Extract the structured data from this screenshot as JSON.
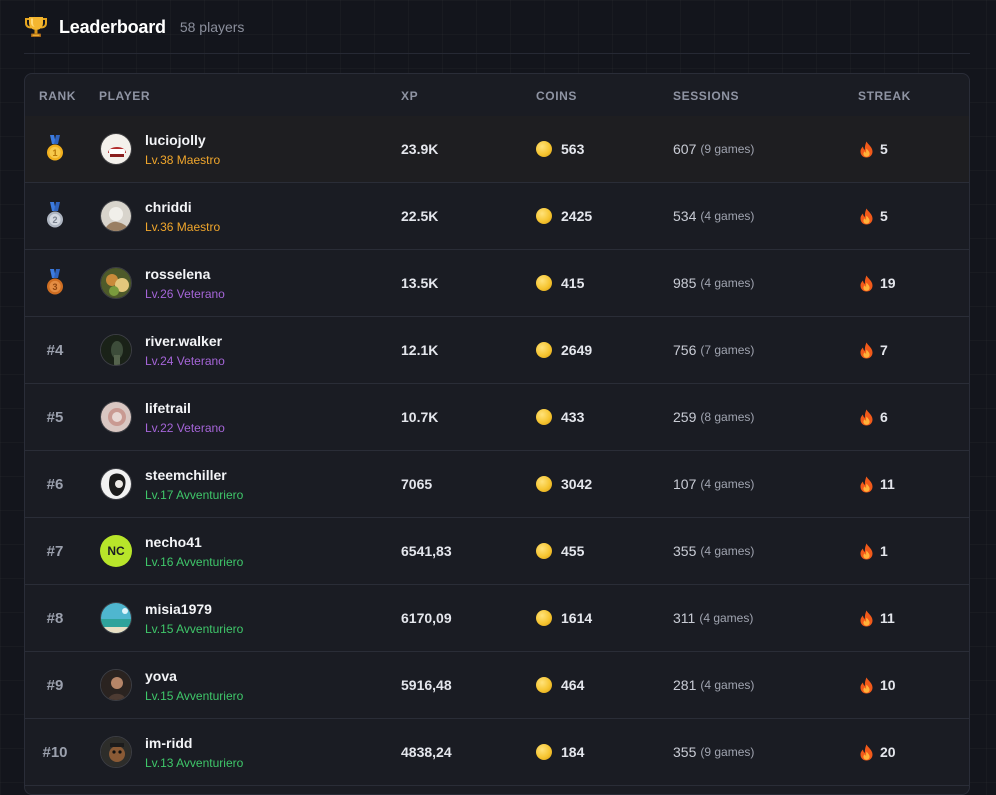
{
  "header": {
    "title": "Leaderboard",
    "count": "58 players",
    "trophy_icon": "trophy-icon"
  },
  "colors": {
    "background": "#13151c",
    "panel": "#1a1c23",
    "maestro": "#f0a62c",
    "veterano": "#a565d8",
    "avventuriero": "#3fc76a",
    "coin": "#f6c531",
    "gold_medal": "#f2b01e",
    "silver_medal": "#b8bec9",
    "bronze_medal": "#d9782a"
  },
  "columns": {
    "rank": "RANK",
    "player": "PLAYER",
    "xp": "XP",
    "coins": "COINS",
    "sessions": "SESSIONS",
    "streak": "STREAK"
  },
  "rows": [
    {
      "rank": "",
      "medal": "gold",
      "name": "luciojolly",
      "level": "Lv.38 Maestro",
      "tier": "maestro",
      "xp": "23.9K",
      "coins": "563",
      "sessions": "607",
      "games": "(9 games)",
      "streak": "5"
    },
    {
      "rank": "",
      "medal": "silver",
      "name": "chriddi",
      "level": "Lv.36 Maestro",
      "tier": "maestro",
      "xp": "22.5K",
      "coins": "2425",
      "sessions": "534",
      "games": "(4 games)",
      "streak": "5"
    },
    {
      "rank": "",
      "medal": "bronze",
      "name": "rosselena",
      "level": "Lv.26 Veterano",
      "tier": "veterano",
      "xp": "13.5K",
      "coins": "415",
      "sessions": "985",
      "games": "(4 games)",
      "streak": "19"
    },
    {
      "rank": "#4",
      "medal": "",
      "name": "river.walker",
      "level": "Lv.24 Veterano",
      "tier": "veterano",
      "xp": "12.1K",
      "coins": "2649",
      "sessions": "756",
      "games": "(7 games)",
      "streak": "7"
    },
    {
      "rank": "#5",
      "medal": "",
      "name": "lifetrail",
      "level": "Lv.22 Veterano",
      "tier": "veterano",
      "xp": "10.7K",
      "coins": "433",
      "sessions": "259",
      "games": "(8 games)",
      "streak": "6"
    },
    {
      "rank": "#6",
      "medal": "",
      "name": "steemchiller",
      "level": "Lv.17 Avventuriero",
      "tier": "avventuriero",
      "xp": "7065",
      "coins": "3042",
      "sessions": "107",
      "games": "(4 games)",
      "streak": "11"
    },
    {
      "rank": "#7",
      "medal": "",
      "name": "necho41",
      "level": "Lv.16 Avventuriero",
      "tier": "avventuriero",
      "xp": "6541,83",
      "coins": "455",
      "sessions": "355",
      "games": "(4 games)",
      "streak": "1",
      "initials": "NC"
    },
    {
      "rank": "#8",
      "medal": "",
      "name": "misia1979",
      "level": "Lv.15 Avventuriero",
      "tier": "avventuriero",
      "xp": "6170,09",
      "coins": "1614",
      "sessions": "311",
      "games": "(4 games)",
      "streak": "11"
    },
    {
      "rank": "#9",
      "medal": "",
      "name": "yova",
      "level": "Lv.15 Avventuriero",
      "tier": "avventuriero",
      "xp": "5916,48",
      "coins": "464",
      "sessions": "281",
      "games": "(4 games)",
      "streak": "10"
    },
    {
      "rank": "#10",
      "medal": "",
      "name": "im-ridd",
      "level": "Lv.13 Avventuriero",
      "tier": "avventuriero",
      "xp": "4838,24",
      "coins": "184",
      "sessions": "355",
      "games": "(9 games)",
      "streak": "20"
    }
  ]
}
